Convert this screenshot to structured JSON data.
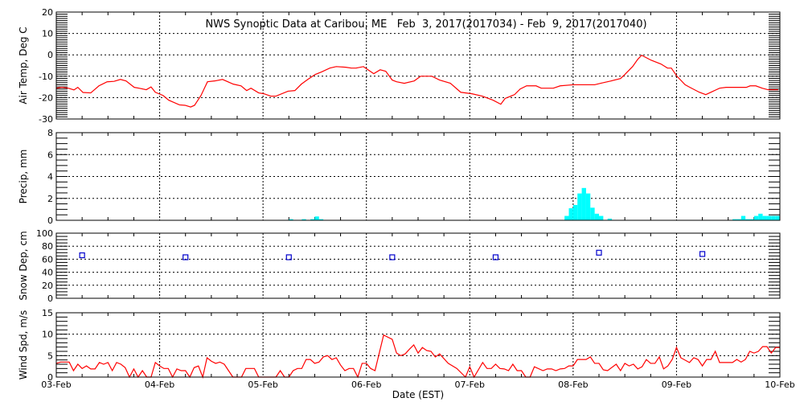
{
  "chart_data": [
    {
      "type": "line",
      "title": "NWS Synoptic Data at Caribou, ME   Feb  3, 2017(2017034) - Feb  9, 2017(2017040)",
      "ylabel": "Air Temp, Deg C",
      "ylim": [
        -30,
        20
      ],
      "yticks": [
        "20",
        "10",
        "0",
        "-10",
        "-20",
        "-30"
      ],
      "color": "#ff0000",
      "x_unit": "hours since 03-Feb 00:00",
      "points": [
        [
          0,
          -15.6
        ],
        [
          1.3,
          -15.2
        ],
        [
          2.8,
          -15.6
        ],
        [
          4.1,
          -16.4
        ],
        [
          5,
          -15.2
        ],
        [
          6.2,
          -17.6
        ],
        [
          8,
          -17.8
        ],
        [
          9.9,
          -14.5
        ],
        [
          11.8,
          -12.6
        ],
        [
          13.4,
          -12.4
        ],
        [
          14.9,
          -11.5
        ],
        [
          16.2,
          -12.2
        ],
        [
          18.1,
          -15.2
        ],
        [
          19.2,
          -15.6
        ],
        [
          20.9,
          -16.3
        ],
        [
          22,
          -15
        ],
        [
          23,
          -17.5
        ],
        [
          24.8,
          -19
        ],
        [
          26.1,
          -21.2
        ],
        [
          28.6,
          -23.4
        ],
        [
          29.9,
          -23.6
        ],
        [
          31.2,
          -24.4
        ],
        [
          32.1,
          -23.6
        ],
        [
          33.6,
          -19
        ],
        [
          35.1,
          -12.6
        ],
        [
          36.8,
          -12.2
        ],
        [
          38.6,
          -11.5
        ],
        [
          41.1,
          -13.7
        ],
        [
          42.9,
          -14.5
        ],
        [
          44.2,
          -16.7
        ],
        [
          45.2,
          -15.6
        ],
        [
          47,
          -17.8
        ],
        [
          48.2,
          -18.2
        ],
        [
          49.8,
          -19.3
        ],
        [
          51,
          -19.3
        ],
        [
          53.8,
          -17
        ],
        [
          55.4,
          -16.7
        ],
        [
          56.9,
          -13.7
        ],
        [
          58.4,
          -11.5
        ],
        [
          60.1,
          -9.2
        ],
        [
          61.6,
          -8
        ],
        [
          63.5,
          -6.2
        ],
        [
          65,
          -5.5
        ],
        [
          67.2,
          -5.8
        ],
        [
          68.5,
          -6.2
        ],
        [
          69.6,
          -6.2
        ],
        [
          71.3,
          -5.5
        ],
        [
          72.4,
          -7
        ],
        [
          73.7,
          -8.8
        ],
        [
          75.2,
          -7
        ],
        [
          76.5,
          -7.7
        ],
        [
          78,
          -11.8
        ],
        [
          79,
          -12.6
        ],
        [
          80.8,
          -13.3
        ],
        [
          83.1,
          -12.2
        ],
        [
          84.6,
          -10
        ],
        [
          87.2,
          -10
        ],
        [
          89,
          -11.8
        ],
        [
          91.5,
          -13.3
        ],
        [
          93.9,
          -17.5
        ],
        [
          96.5,
          -18.2
        ],
        [
          98.9,
          -19.3
        ],
        [
          101.4,
          -21.2
        ],
        [
          103.2,
          -23.1
        ],
        [
          104.2,
          -20.4
        ],
        [
          106.4,
          -18.6
        ],
        [
          107.7,
          -16
        ],
        [
          109.2,
          -14.5
        ],
        [
          111.4,
          -14.5
        ],
        [
          112.6,
          -15.6
        ],
        [
          115.4,
          -15.6
        ],
        [
          117,
          -14.5
        ],
        [
          120,
          -14
        ],
        [
          125,
          -14
        ],
        [
          126.4,
          -13.3
        ],
        [
          128.8,
          -12.2
        ],
        [
          131,
          -11.1
        ],
        [
          132,
          -9.2
        ],
        [
          133.8,
          -5.5
        ],
        [
          135,
          -2.1
        ],
        [
          135.9,
          -0.2
        ],
        [
          138.1,
          -2.5
        ],
        [
          140.4,
          -4.3
        ],
        [
          141.9,
          -6.2
        ],
        [
          142.8,
          -6.2
        ],
        [
          144.1,
          -10
        ],
        [
          146,
          -14
        ],
        [
          147.1,
          -15.2
        ],
        [
          149.3,
          -17.5
        ],
        [
          150.8,
          -18.6
        ],
        [
          152.5,
          -17
        ],
        [
          154,
          -15.6
        ],
        [
          155.5,
          -15.2
        ],
        [
          160.2,
          -15.2
        ],
        [
          161.1,
          -14.5
        ],
        [
          162.4,
          -14.5
        ],
        [
          163.9,
          -15.6
        ],
        [
          165.2,
          -16.3
        ],
        [
          167.6,
          -16.3
        ]
      ]
    },
    {
      "type": "bar",
      "ylabel": "Precip, mm",
      "ylim": [
        0,
        8
      ],
      "yticks": [
        "8",
        "6",
        "4",
        "2",
        "0"
      ],
      "color": "#00ffff",
      "x_unit": "hours since 03-Feb 00:00",
      "points": [
        [
          54,
          0.1
        ],
        [
          57,
          0.1
        ],
        [
          59,
          0.1
        ],
        [
          60,
          0.35
        ],
        [
          61,
          0.1
        ],
        [
          118,
          0.4
        ],
        [
          119,
          1.1
        ],
        [
          120,
          1.4
        ],
        [
          121,
          2.45
        ],
        [
          122,
          2.95
        ],
        [
          123,
          2.45
        ],
        [
          124,
          1.15
        ],
        [
          125,
          0.6
        ],
        [
          126,
          0.4
        ],
        [
          128,
          0.15
        ],
        [
          157,
          0.1
        ],
        [
          158,
          0.1
        ],
        [
          159,
          0.4
        ],
        [
          160,
          0.1
        ],
        [
          161,
          0.1
        ],
        [
          162,
          0.4
        ],
        [
          163,
          0.6
        ],
        [
          164,
          0.4
        ],
        [
          165,
          0.4
        ],
        [
          166,
          0.4
        ],
        [
          167,
          0.4
        ]
      ]
    },
    {
      "type": "scatter",
      "ylabel": "Snow Dep, cm",
      "ylim": [
        0,
        100
      ],
      "yticks": [
        "100",
        "80",
        "60",
        "40",
        "20",
        "0"
      ],
      "color": "#0000cc",
      "x_unit": "hours since 03-Feb 00:00",
      "points": [
        [
          6,
          66
        ],
        [
          30,
          63
        ],
        [
          54,
          63
        ],
        [
          78,
          63
        ],
        [
          102,
          63
        ],
        [
          126,
          70
        ],
        [
          150,
          68
        ]
      ]
    },
    {
      "type": "line",
      "ylabel": "Wind Spd, m/s",
      "ylim": [
        0,
        15
      ],
      "yticks": [
        "15",
        "10",
        "5",
        "0"
      ],
      "color": "#ff0000",
      "xlabel": "Date (EST)",
      "xticks": [
        "03-Feb",
        "04-Feb",
        "05-Feb",
        "06-Feb",
        "07-Feb",
        "08-Feb",
        "09-Feb",
        "10-Feb"
      ],
      "x_unit": "hours since 03-Feb 00:00",
      "points": [
        [
          0,
          3.2
        ],
        [
          1,
          3.5
        ],
        [
          3,
          3.5
        ],
        [
          4,
          1.5
        ],
        [
          5,
          3
        ],
        [
          6,
          2
        ],
        [
          7,
          2.6
        ],
        [
          8,
          1.9
        ],
        [
          9,
          1.9
        ],
        [
          10,
          3.4
        ],
        [
          11,
          3
        ],
        [
          12,
          3.4
        ],
        [
          13,
          1.5
        ],
        [
          14,
          3.4
        ],
        [
          15,
          3
        ],
        [
          16,
          2.2
        ],
        [
          17,
          0
        ],
        [
          18,
          1.9
        ],
        [
          19,
          0
        ],
        [
          20,
          1.5
        ],
        [
          21,
          0
        ],
        [
          22,
          0
        ],
        [
          23,
          3.4
        ],
        [
          24,
          2.6
        ],
        [
          25,
          2
        ],
        [
          26,
          2
        ],
        [
          27,
          0
        ],
        [
          28,
          1.9
        ],
        [
          29,
          1.5
        ],
        [
          30,
          1.5
        ],
        [
          31,
          0
        ],
        [
          32,
          2.2
        ],
        [
          33,
          2.6
        ],
        [
          34,
          0
        ],
        [
          35,
          4.5
        ],
        [
          36,
          3.7
        ],
        [
          37,
          3.2
        ],
        [
          38,
          3.5
        ],
        [
          39,
          3
        ],
        [
          40,
          1.5
        ],
        [
          41,
          0
        ],
        [
          43,
          0
        ],
        [
          44,
          2
        ],
        [
          46,
          2
        ],
        [
          47,
          0
        ],
        [
          51,
          0
        ],
        [
          52,
          1.5
        ],
        [
          53,
          0
        ],
        [
          54,
          0
        ],
        [
          55,
          1.5
        ],
        [
          56,
          2
        ],
        [
          57,
          2
        ],
        [
          58,
          4.1
        ],
        [
          59,
          4.1
        ],
        [
          60,
          3.2
        ],
        [
          61,
          3.5
        ],
        [
          62,
          4.7
        ],
        [
          63,
          5
        ],
        [
          64,
          4.1
        ],
        [
          65,
          4.5
        ],
        [
          66,
          2.8
        ],
        [
          67,
          1.5
        ],
        [
          68,
          2
        ],
        [
          69,
          2
        ],
        [
          70,
          0
        ],
        [
          71,
          3.2
        ],
        [
          72,
          3.2
        ],
        [
          73,
          2
        ],
        [
          74,
          1.5
        ],
        [
          76,
          9.8
        ],
        [
          78,
          8.8
        ],
        [
          79,
          5.6
        ],
        [
          80,
          5
        ],
        [
          81,
          5.4
        ],
        [
          82,
          6.5
        ],
        [
          83,
          7.5
        ],
        [
          84,
          5.6
        ],
        [
          85,
          6.9
        ],
        [
          86,
          6.2
        ],
        [
          87,
          6
        ],
        [
          88,
          4.7
        ],
        [
          89,
          5.4
        ],
        [
          91,
          3.2
        ],
        [
          93,
          2
        ],
        [
          95,
          0
        ],
        [
          96,
          2.4
        ],
        [
          97,
          0
        ],
        [
          99,
          3.4
        ],
        [
          100,
          2
        ],
        [
          101,
          2
        ],
        [
          102,
          3
        ],
        [
          103,
          2
        ],
        [
          104,
          1.9
        ],
        [
          105,
          1.5
        ],
        [
          106,
          3
        ],
        [
          107,
          1.5
        ],
        [
          108,
          1.5
        ],
        [
          109,
          0
        ],
        [
          110,
          0
        ],
        [
          111,
          2.4
        ],
        [
          113,
          1.5
        ],
        [
          114,
          1.9
        ],
        [
          115,
          1.9
        ],
        [
          116,
          1.5
        ],
        [
          117,
          1.9
        ],
        [
          118,
          2
        ],
        [
          119,
          2.6
        ],
        [
          120,
          2.6
        ],
        [
          121,
          4.1
        ],
        [
          123,
          4.1
        ],
        [
          124,
          4.7
        ],
        [
          125,
          3.2
        ],
        [
          126,
          3.2
        ],
        [
          127,
          1.7
        ],
        [
          128,
          1.5
        ],
        [
          130,
          3
        ],
        [
          131,
          1.5
        ],
        [
          132,
          3.2
        ],
        [
          133,
          2.6
        ],
        [
          134,
          3
        ],
        [
          135,
          1.9
        ],
        [
          136,
          2.4
        ],
        [
          137,
          4.1
        ],
        [
          138,
          3.2
        ],
        [
          139,
          3.2
        ],
        [
          140,
          4.7
        ],
        [
          141,
          1.9
        ],
        [
          142,
          2.6
        ],
        [
          143,
          4.1
        ],
        [
          144,
          6.9
        ],
        [
          145,
          4.5
        ],
        [
          147,
          3.4
        ],
        [
          148,
          4.5
        ],
        [
          149,
          4.1
        ],
        [
          150,
          2.6
        ],
        [
          151,
          4.1
        ],
        [
          152,
          4.1
        ],
        [
          153,
          6
        ],
        [
          154,
          3.4
        ],
        [
          157,
          3.4
        ],
        [
          158,
          4.1
        ],
        [
          159,
          3.5
        ],
        [
          160,
          4.1
        ],
        [
          161,
          6
        ],
        [
          162,
          5.6
        ],
        [
          163,
          6
        ],
        [
          164,
          7.1
        ],
        [
          165,
          7.1
        ],
        [
          166,
          5.6
        ],
        [
          167,
          6.9
        ],
        [
          168,
          6.9
        ]
      ]
    }
  ]
}
